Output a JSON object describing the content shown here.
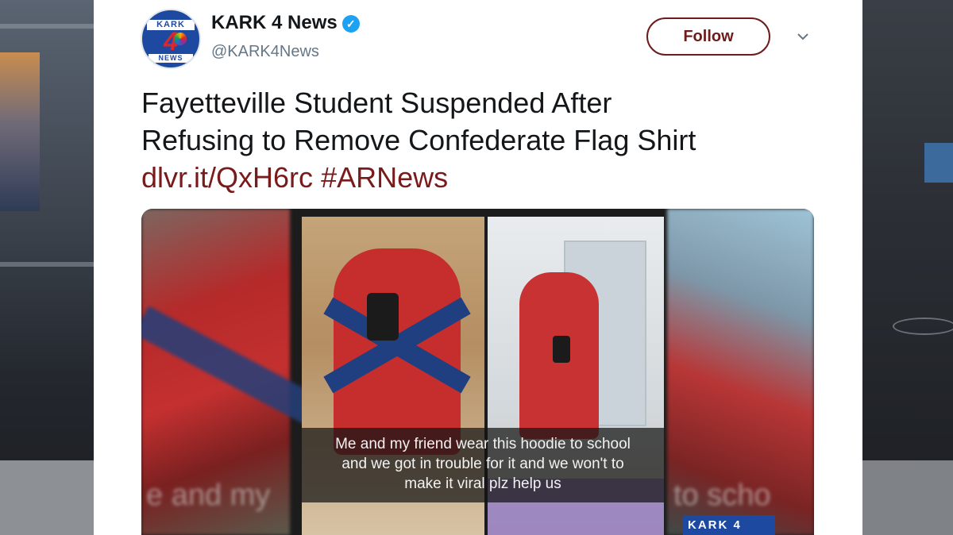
{
  "account": {
    "name": "KARK 4 News",
    "handle": "@KARK4News",
    "avatar_top": "KARK",
    "avatar_number": "4",
    "avatar_bottom": "NEWS"
  },
  "follow_button": {
    "label": "Follow"
  },
  "tweet": {
    "line1": "Fayetteville Student Suspended After",
    "line2": "Refusing to Remove Confederate Flag Shirt",
    "link": "dlvr.it/QxH6rc",
    "hashtag": "#ARNews"
  },
  "media": {
    "caption_line1": "Me and my friend wear this hoodie to school",
    "caption_line2": "and we got in trouble for it and we won't to",
    "caption_line3": "make it viral plz help us",
    "blur_left_text": "e and my",
    "blur_right_text": "to scho",
    "watermark": "KARK 4"
  },
  "colors": {
    "link": "#7a1b1b",
    "follow_border": "#6e1b1b",
    "verified": "#1da1f2"
  },
  "icons": [
    "verified-badge-icon",
    "chevron-down-icon",
    "nbc-peacock-icon"
  ]
}
